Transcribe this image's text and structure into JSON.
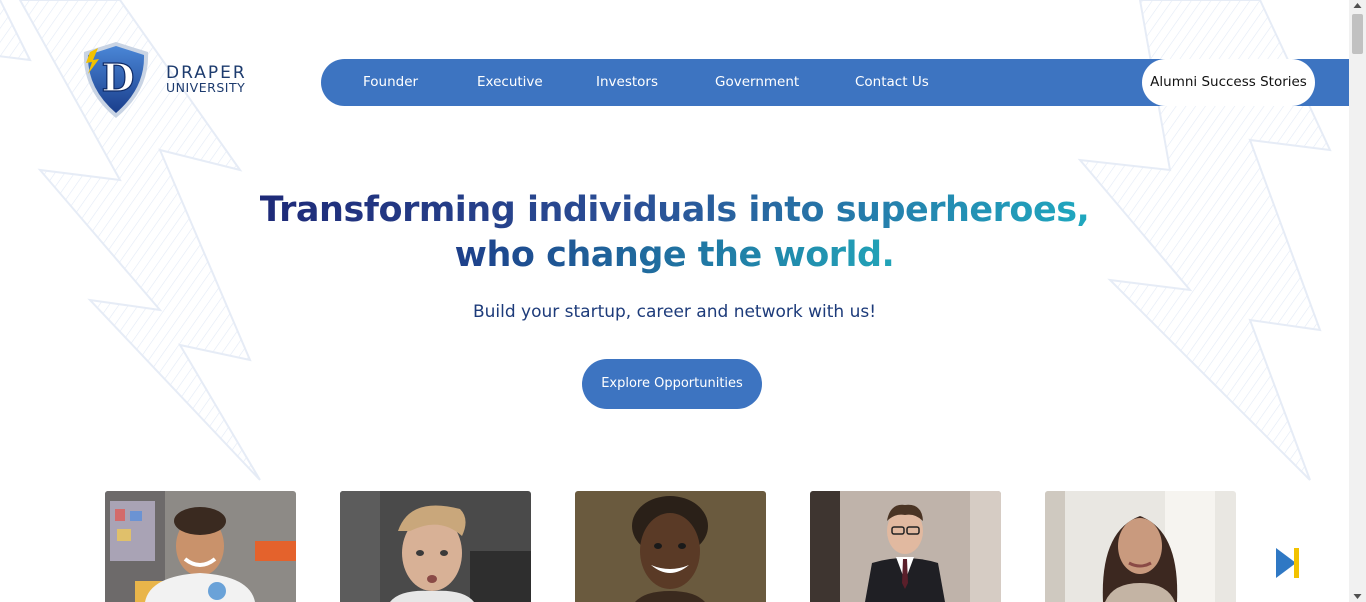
{
  "brand": {
    "logo_letter": "D",
    "name_line1": "DRAPER",
    "name_line2": "UNIVERSITY"
  },
  "nav": {
    "items": [
      {
        "label": "Founder"
      },
      {
        "label": "Executive"
      },
      {
        "label": "Investors"
      },
      {
        "label": "Government"
      },
      {
        "label": "Contact Us"
      }
    ],
    "cta_label": "Alumni Success Stories"
  },
  "hero": {
    "title_line1": "Transforming individuals into superheroes,",
    "title_line2": "who change the world.",
    "subtitle": "Build your startup, career and network with us!",
    "button_label": "Explore Opportunities"
  },
  "profiles": [
    {
      "description": "smiling young man with curly hair in a studio"
    },
    {
      "description": "young man with blond hair making a surprised face"
    },
    {
      "description": "smiling woman with braided hair"
    },
    {
      "description": "young man with glasses in a dark suit"
    },
    {
      "description": "woman with long dark hair in a bright room"
    }
  ],
  "colors": {
    "primary_blue": "#3d74c1",
    "title_navy": "#1e2a78",
    "title_teal": "#20a8bf",
    "subtitle_navy": "#1d3b7a",
    "arrow_blue": "#2f78c4",
    "arrow_yellow": "#f2c200"
  },
  "icons": {
    "logo": "shield-lightning-logo",
    "carousel_next": "play-arrow-icon"
  }
}
